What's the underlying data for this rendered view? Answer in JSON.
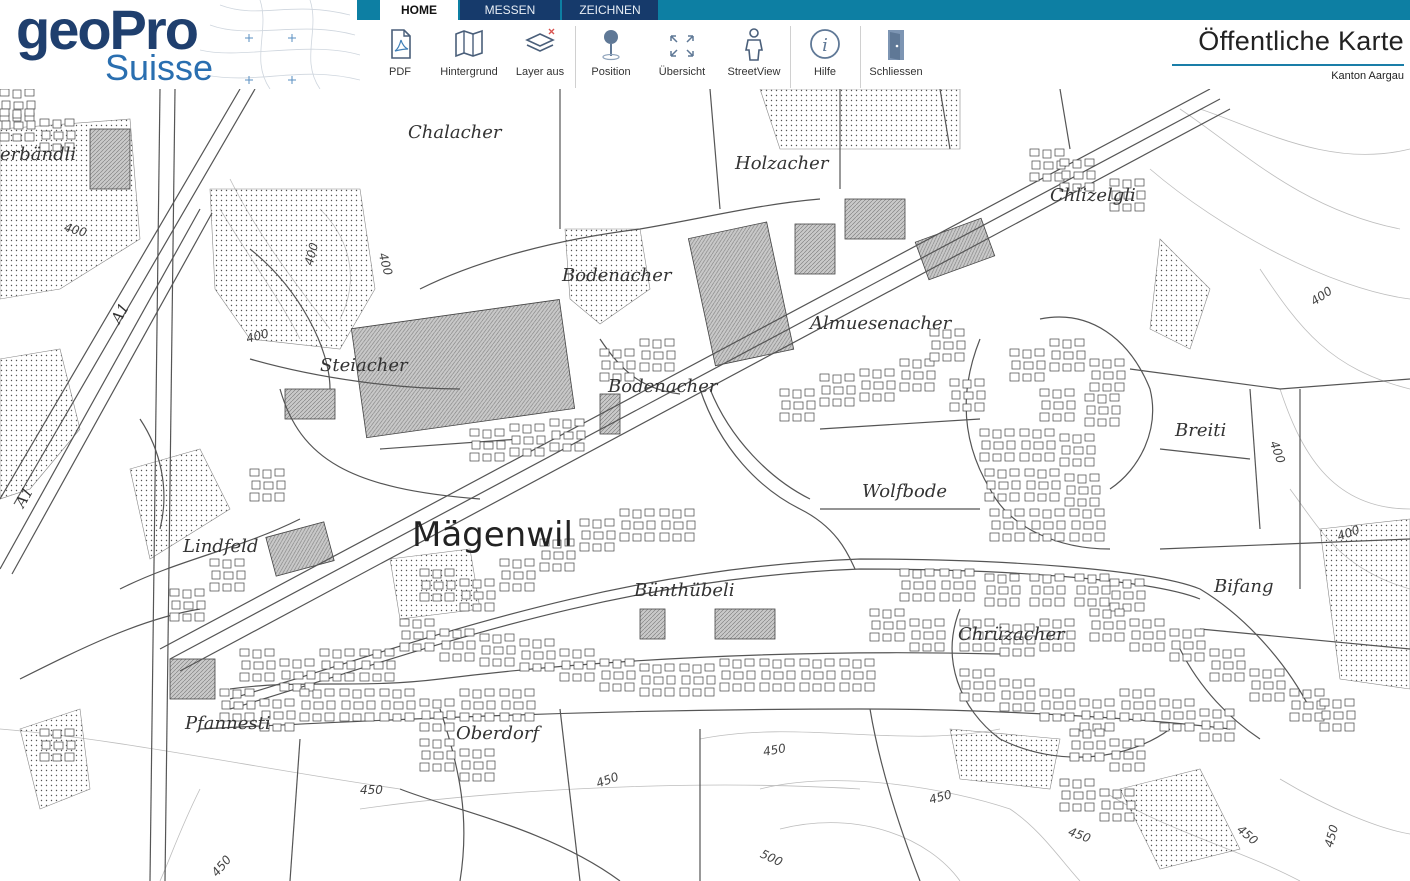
{
  "logo": {
    "line1": "geoPro",
    "line2": "Suisse"
  },
  "tabs": {
    "home": "HOME",
    "messen": "MESSEN",
    "zeichnen": "ZEICHNEN"
  },
  "tools": {
    "pdf": "PDF",
    "hintergrund": "Hintergrund",
    "layer_aus": "Layer aus",
    "position": "Position",
    "uebersicht": "Übersicht",
    "streetview": "StreetView",
    "hilfe": "Hilfe",
    "schliessen": "Schliessen"
  },
  "header": {
    "title": "Öffentliche Karte",
    "subtitle": "Kanton Aargau"
  },
  "map": {
    "town": "Mägenwil",
    "places": {
      "chalacher": "Chalacher",
      "holzacher": "Holzacher",
      "chlizelgli": "Chlizelgli",
      "erbaendli": "erbändli",
      "bodenacher1": "Bodenacher",
      "bodenacher2": "Bodenacher",
      "almuesenacher": "Almuesenacher",
      "steiacher": "Steiacher",
      "breiti": "Breiti",
      "wolfbode": "Wolfbode",
      "lindfeld": "Lindfeld",
      "buenthubeli": "Bünthübeli",
      "bifang": "Bifang",
      "chruezacher": "Chrüzacher",
      "pfannesti": "Pfannesti",
      "oberdorf": "Oberdorf"
    },
    "roads": {
      "a1_top": "A1",
      "a1_left": "A1"
    },
    "contours": {
      "c400a": "400",
      "c400b": "400",
      "c400c": "400",
      "c400d": "400",
      "c400e": "400",
      "c400f": "400",
      "c400g": "400",
      "c450a": "450",
      "c450b": "450",
      "c450c": "450",
      "c450d": "450",
      "c450e": "450",
      "c450f": "450",
      "c450g": "450",
      "c500": "500"
    }
  },
  "colors": {
    "brand_dark": "#1f3f6e",
    "brand_light": "#2a6fb0",
    "topbar": "#0d7fa3",
    "tab_dark": "#163a6b"
  }
}
